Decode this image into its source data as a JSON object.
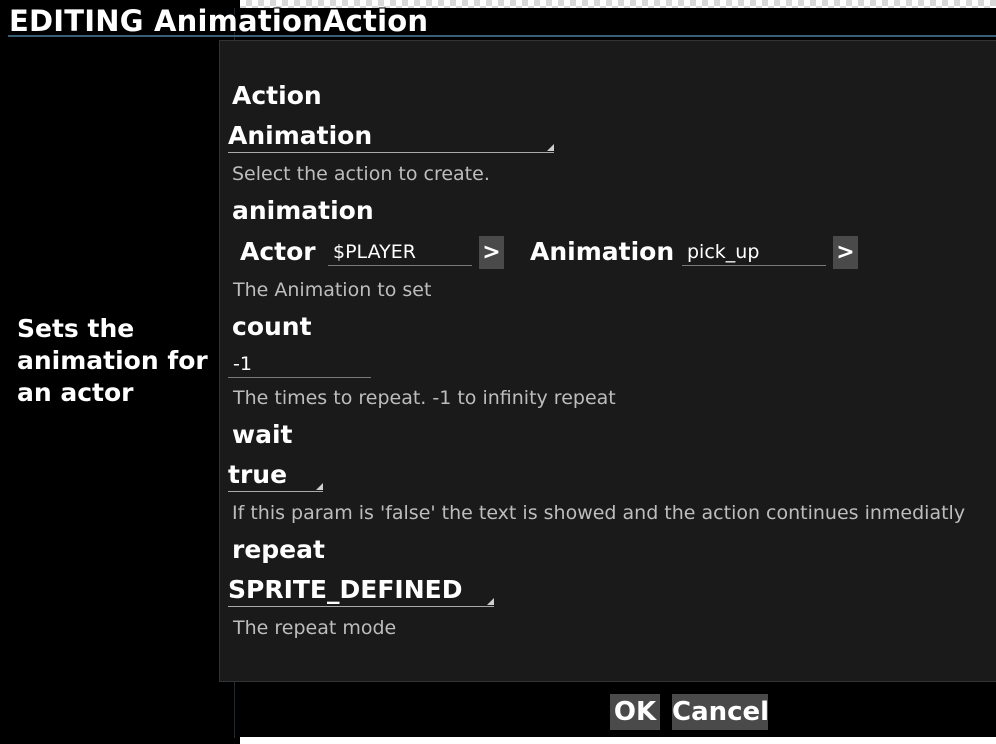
{
  "window": {
    "title": "EDITING AnimationAction"
  },
  "description": "Sets the animation for an actor",
  "fields": {
    "action": {
      "label": "Action",
      "selected": "Animation",
      "hint": "Select the action to create."
    },
    "animation": {
      "label": "animation",
      "actor_label": "Actor",
      "actor_value": "$PLAYER",
      "actor_button": ">",
      "animation_label": "Animation",
      "animation_value": "pick_up",
      "animation_button": ">",
      "hint": "The Animation to set"
    },
    "count": {
      "label": "count",
      "value": "-1",
      "hint": "The times to repeat. -1 to infinity repeat"
    },
    "wait": {
      "label": "wait",
      "selected": "true",
      "hint": "If this param is 'false' the text is showed and the action continues inmediatly"
    },
    "repeat": {
      "label": "repeat",
      "selected": "SPRITE_DEFINED",
      "hint": "The repeat mode"
    }
  },
  "buttons": {
    "ok": "OK",
    "cancel": "Cancel"
  },
  "colors": {
    "panel": "#1a1a1a",
    "background": "#000000",
    "button": "#4a4a4a",
    "hint_text": "#bdbdbd",
    "title_line": "#3a5f74"
  },
  "icons": {
    "dropdown": "corner-triangle-icon",
    "go": "chevron-right-icon"
  }
}
